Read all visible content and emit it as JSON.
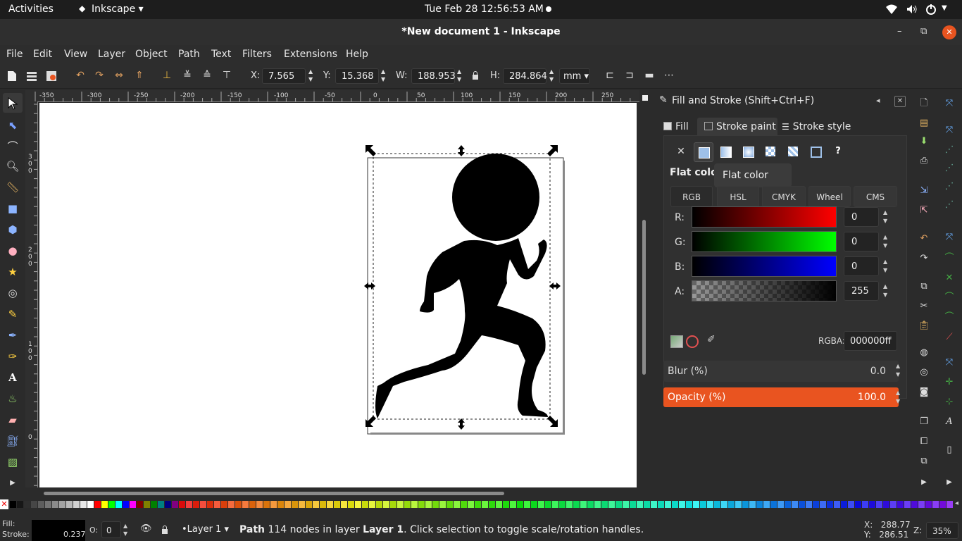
{
  "topbar": {
    "activities": "Activities",
    "app_menu": "Inkscape ▾",
    "clock": "Tue Feb 28  12:56:53 AM",
    "wifi_icon": "wifi-icon",
    "sound_icon": "speaker-icon",
    "power_icon": "power-icon"
  },
  "window": {
    "title": "*New document 1 - Inkscape",
    "minimize": "–",
    "maximize": "⧉",
    "close": "✕"
  },
  "menubar": [
    "File",
    "Edit",
    "View",
    "Layer",
    "Object",
    "Path",
    "Text",
    "Filters",
    "Extensions",
    "Help"
  ],
  "toolbar": {
    "x_label": "X:",
    "x_value": "7.565",
    "y_label": "Y:",
    "y_value": "15.368",
    "w_label": "W:",
    "w_value": "188.953",
    "h_label": "H:",
    "h_value": "284.864",
    "unit": "mm",
    "lock_icon": "lock-icon"
  },
  "ruler": {
    "h_ticks": [
      "-350",
      "-300",
      "-250",
      "-200",
      "-150",
      "-100",
      "-50",
      "0",
      "50",
      "100",
      "150",
      "200",
      "250"
    ],
    "v_ticks": [
      [
        "3",
        "0",
        "0"
      ],
      [
        "2",
        "0",
        "0"
      ],
      [
        "1",
        "0",
        "0"
      ],
      [
        "0"
      ]
    ]
  },
  "panel": {
    "title": "Fill and Stroke (Shift+Ctrl+F)",
    "tabs": [
      "Fill",
      "Stroke paint",
      "Stroke style"
    ],
    "paint_types": [
      "✕",
      "flat",
      "linear",
      "radial",
      "pattern",
      "swatch",
      "unset",
      "?"
    ],
    "section": "Flat colo",
    "tooltip": "Flat color",
    "modes": [
      "RGB",
      "HSL",
      "CMYK",
      "Wheel",
      "CMS"
    ],
    "channels": [
      {
        "label": "R:",
        "value": "0"
      },
      {
        "label": "G:",
        "value": "0"
      },
      {
        "label": "B:",
        "value": "0"
      },
      {
        "label": "A:",
        "value": "255"
      }
    ],
    "rgba_label": "RGBA:",
    "rgba_value": "000000ff",
    "blur_label": "Blur (%)",
    "blur_value": "0.0",
    "opacity_label": "Opacity (%)",
    "opacity_value": "100.0",
    "accent": "#e95420"
  },
  "status": {
    "fill_label": "Fill:",
    "stroke_label": "Stroke:",
    "stroke_width": "0.237",
    "o_label": "O:",
    "o_value": "0",
    "layer": "•Layer 1",
    "msg_bold1": "Path",
    "msg_1": " 114 nodes in layer ",
    "msg_bold2": "Layer 1",
    "msg_2": ". Click selection to toggle scale/rotation handles.",
    "x_coord": "X:   288.77",
    "y_coord": "Y:   286.51",
    "z_label": "Z:",
    "zoom": "35%"
  }
}
